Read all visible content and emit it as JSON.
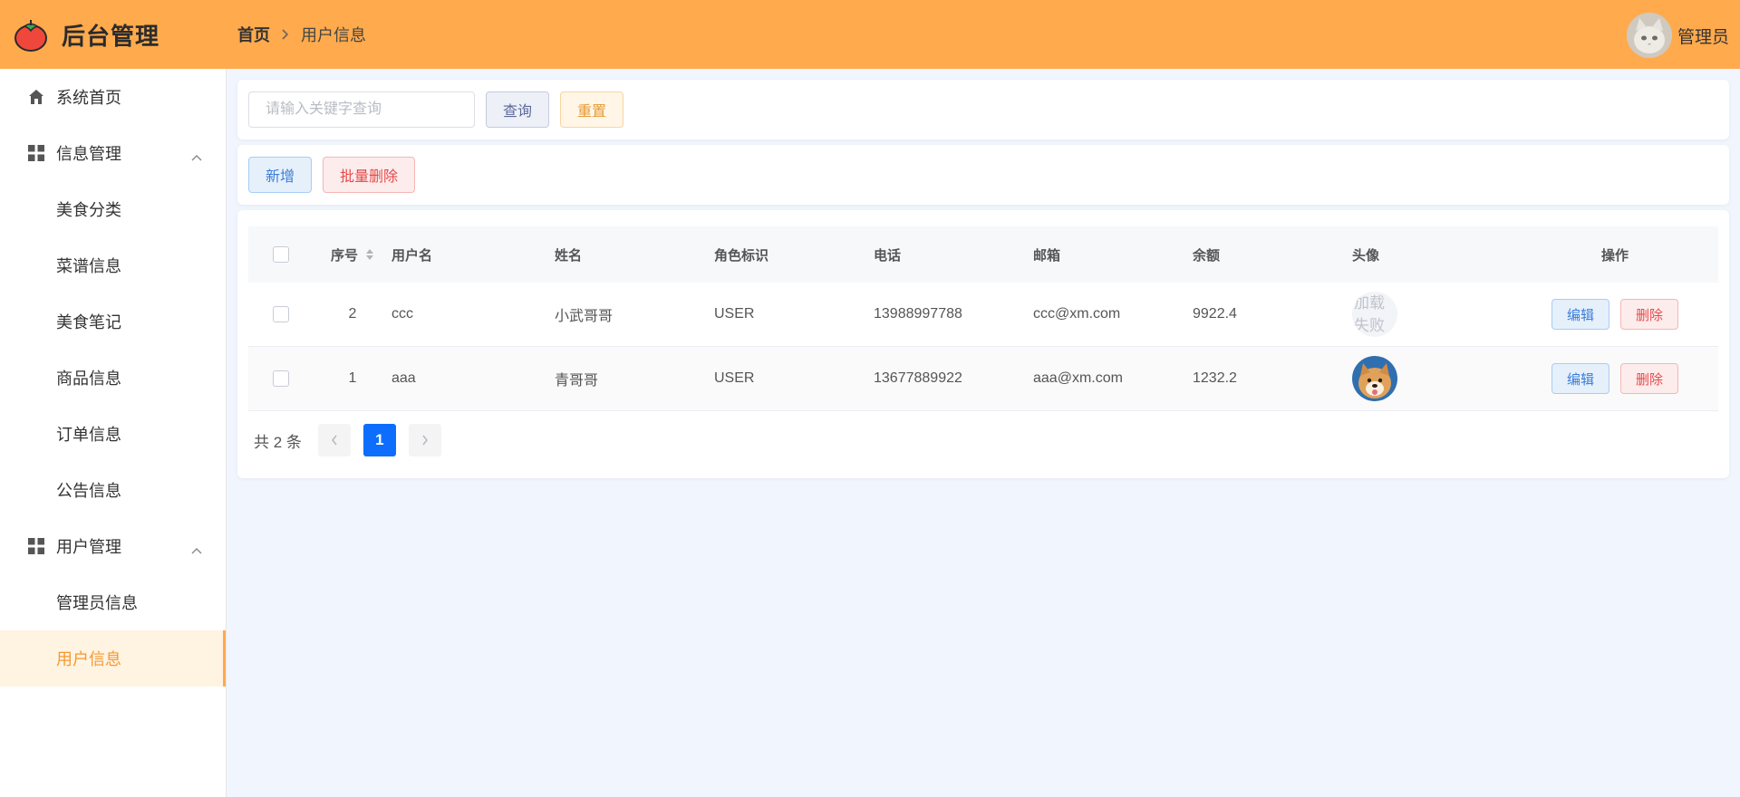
{
  "header": {
    "app_title": "后台管理",
    "breadcrumb_home": "首页",
    "breadcrumb_current": "用户信息",
    "user_name": "管理员"
  },
  "sidebar": {
    "home": "系统首页",
    "group_info": "信息管理",
    "info_items": [
      "美食分类",
      "菜谱信息",
      "美食笔记",
      "商品信息",
      "订单信息",
      "公告信息"
    ],
    "group_user": "用户管理",
    "user_items": [
      "管理员信息",
      "用户信息"
    ],
    "active_item": "用户信息"
  },
  "search": {
    "placeholder": "请输入关键字查询",
    "query_label": "查询",
    "reset_label": "重置"
  },
  "actions": {
    "add_label": "新增",
    "batch_delete_label": "批量删除"
  },
  "table": {
    "columns": [
      "序号",
      "用户名",
      "姓名",
      "角色标识",
      "电话",
      "邮箱",
      "余额",
      "头像",
      "操作"
    ],
    "rows": [
      {
        "no": "2",
        "username": "ccc",
        "name": "小武哥哥",
        "role": "USER",
        "phone": "13988997788",
        "email": "ccc@xm.com",
        "balance": "9922.4",
        "avatar_text": "加载失败",
        "avatar_failed": true
      },
      {
        "no": "1",
        "username": "aaa",
        "name": "青哥哥",
        "role": "USER",
        "phone": "13677889922",
        "email": "aaa@xm.com",
        "balance": "1232.2",
        "avatar_text": "",
        "avatar_failed": false
      }
    ],
    "edit_label": "编辑",
    "delete_label": "删除"
  },
  "pagination": {
    "total_text": "共 2 条",
    "current_page": "1"
  },
  "colors": {
    "header_bg": "#ffaa4d",
    "active_menu_text": "#f39a33",
    "active_menu_bg": "#fff3e2",
    "primary": "#0d6efd",
    "danger": "#e64a4a"
  }
}
